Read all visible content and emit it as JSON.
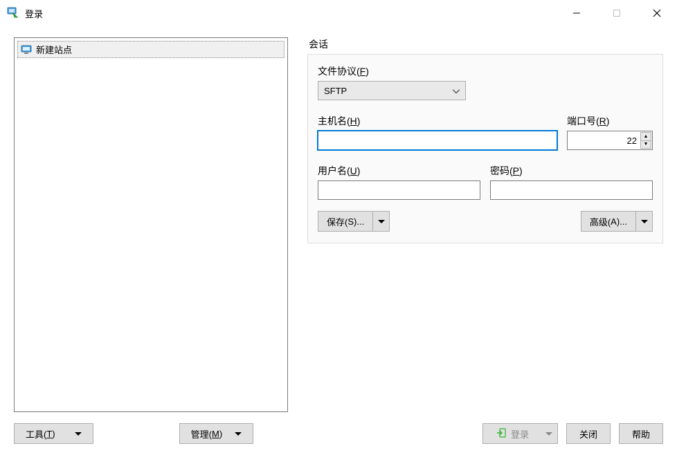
{
  "window": {
    "title": "登录"
  },
  "sites": {
    "items": [
      {
        "label": "新建站点"
      }
    ]
  },
  "session": {
    "group_label": "会话",
    "protocol_label_text": "文件协议(",
    "protocol_mnemonic": "F",
    "protocol_label_close": ")",
    "protocol_value": "SFTP",
    "host_label_text": "主机名(",
    "host_mnemonic": "H",
    "host_label_close": ")",
    "host_value": "",
    "port_label_text": "端口号(",
    "port_mnemonic": "R",
    "port_label_close": ")",
    "port_value": "22",
    "user_label_text": "用户名(",
    "user_mnemonic": "U",
    "user_label_close": ")",
    "user_value": "",
    "pass_label_text": "密码(",
    "pass_mnemonic": "P",
    "pass_label_close": ")",
    "pass_value": "",
    "save_label_text": "保存(",
    "save_mnemonic": "S",
    "save_label_close": ")...",
    "advanced_label_text": "高级(",
    "advanced_mnemonic": "A",
    "advanced_label_close": ")..."
  },
  "bottom": {
    "tools_label_text": "工具(",
    "tools_mnemonic": "T",
    "tools_label_close": ")",
    "manage_label_text": "管理(",
    "manage_mnemonic": "M",
    "manage_label_close": ")",
    "login_label": "登录",
    "close_label": "关闭",
    "help_label": "帮助"
  }
}
